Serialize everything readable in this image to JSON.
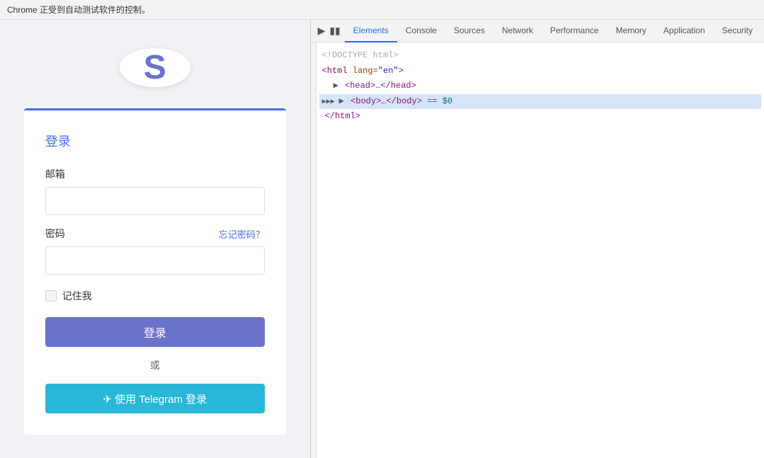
{
  "chrome": {
    "automation_notice": "Chrome 正受到自动测试软件的控制。"
  },
  "login": {
    "logo_letter": "S",
    "title": "登录",
    "email_label": "邮箱",
    "password_label": "密码",
    "forgot_link": "忘记密码？",
    "remember_label": "记住我",
    "login_button": "登录",
    "or_text": "或",
    "telegram_button": "✈ 使用 Telegram 登录"
  },
  "devtools": {
    "tabs": [
      "Elements",
      "Console",
      "Sources",
      "Network",
      "Performance",
      "Memory",
      "Application",
      "Security"
    ],
    "active_tab": "Elements",
    "dom": [
      {
        "line": "<!DOCTYPE html>",
        "type": "comment"
      },
      {
        "line": "<html lang=\"en\">",
        "type": "tag"
      },
      {
        "line": "▶ <head>…</head>",
        "type": "collapsed"
      },
      {
        "line": "▶ <body>…</body>",
        "type": "selected",
        "suffix": " == $0"
      },
      {
        "line": "</html>",
        "type": "tag"
      }
    ]
  }
}
